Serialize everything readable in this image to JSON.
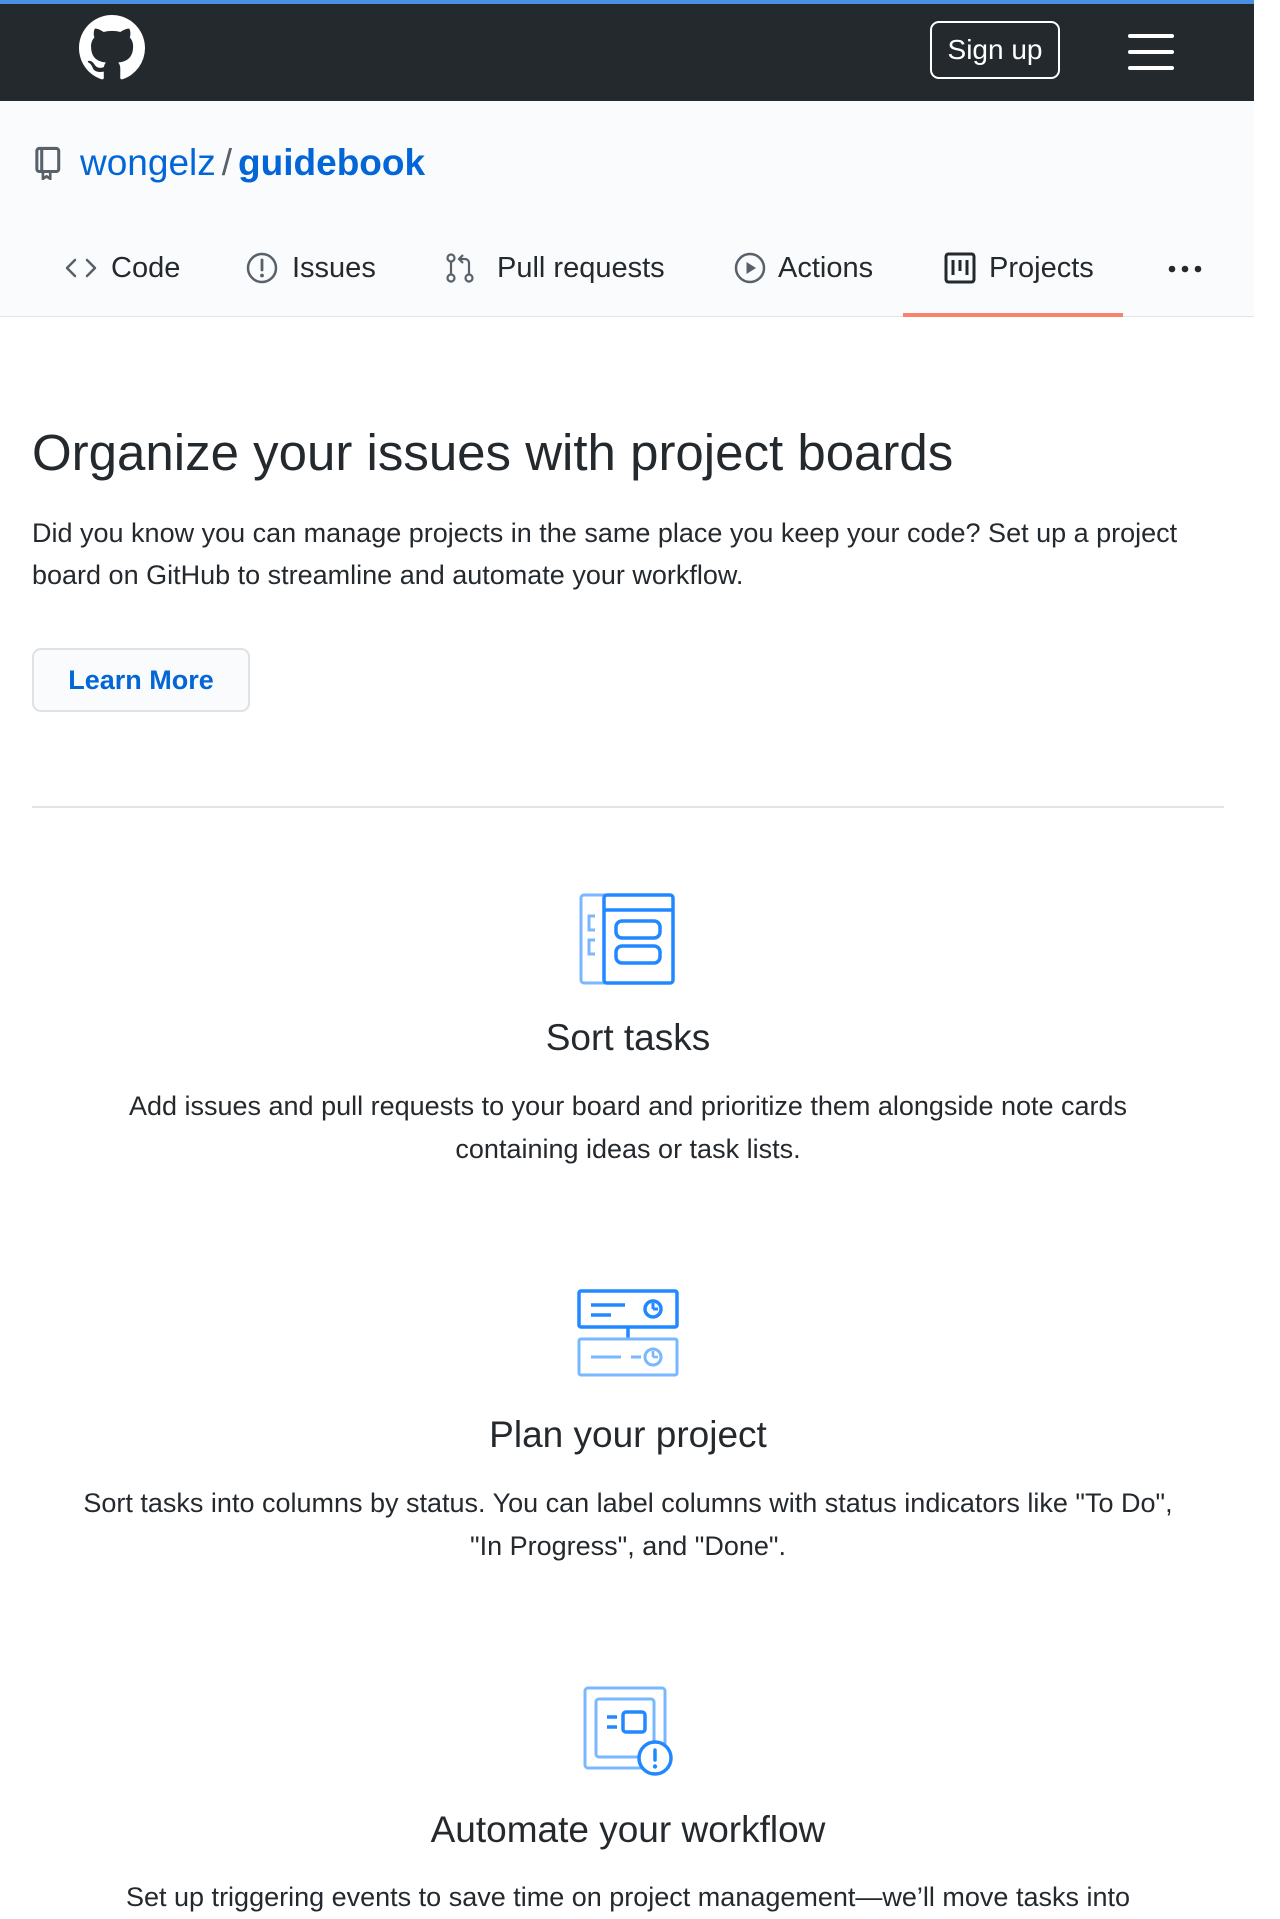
{
  "header": {
    "logo_icon": "github-mark-icon",
    "signup_label": "Sign up",
    "menu_icon": "hamburger-menu-icon"
  },
  "repo": {
    "icon": "repo-icon",
    "owner": "wongelz",
    "separator": "/",
    "name": "guidebook"
  },
  "tabs": [
    {
      "label": "Code",
      "icon": "code-icon",
      "selected": false
    },
    {
      "label": "Issues",
      "icon": "issue-opened-icon",
      "selected": false
    },
    {
      "label": "Pull requests",
      "icon": "git-pull-request-icon",
      "selected": false
    },
    {
      "label": "Actions",
      "icon": "play-icon",
      "selected": false
    },
    {
      "label": "Projects",
      "icon": "project-icon",
      "selected": true
    }
  ],
  "more_tabs_icon": "kebab-horizontal-icon",
  "main": {
    "headline": "Organize your issues with project boards",
    "intro": "Did you know you can manage projects in the same place you keep your code? Set up a project board on GitHub to streamline and automate your workflow.",
    "learn_more_label": "Learn More"
  },
  "features": [
    {
      "icon": "sort-tasks-icon",
      "title": "Sort tasks",
      "description": "Add issues and pull requests to your board and prioritize them alongside note cards containing ideas or task lists."
    },
    {
      "icon": "plan-project-icon",
      "title": "Plan your project",
      "description": "Sort tasks into columns by status. You can label columns with status indicators like \"To Do\", \"In Progress\", and \"Done\"."
    },
    {
      "icon": "automate-workflow-icon",
      "title": "Automate your workflow",
      "description": "Set up triggering events to save time on project management—we’ll move tasks into"
    }
  ],
  "colors": {
    "header_bg": "#24292e",
    "link": "#0366d6",
    "selected_underline": "#f9826c",
    "icon_blue": "#2188ff"
  }
}
